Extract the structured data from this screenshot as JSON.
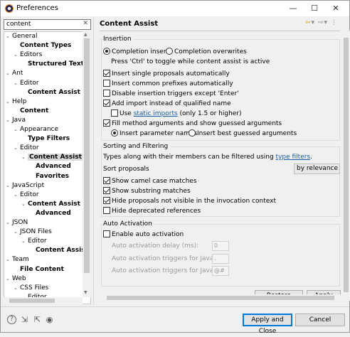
{
  "window": {
    "title": "Preferences",
    "minimize": "—",
    "maximize": "☐",
    "close": "✕"
  },
  "filter": {
    "value": "content",
    "clear": "✕"
  },
  "tree": [
    {
      "label": "General",
      "expander": "⌄",
      "bold": false
    },
    {
      "label": "Content Types",
      "expander": "",
      "bold": true
    },
    {
      "label": "Editors",
      "expander": "⌄",
      "bold": false
    },
    {
      "label": "Structured Text Ed",
      "expander": "",
      "bold": true
    },
    {
      "label": "Ant",
      "expander": "⌄",
      "bold": false
    },
    {
      "label": "Editor",
      "expander": "⌄",
      "bold": false
    },
    {
      "label": "Content Assist",
      "expander": "",
      "bold": true
    },
    {
      "label": "Help",
      "expander": "⌄",
      "bold": false
    },
    {
      "label": "Content",
      "expander": "",
      "bold": true
    },
    {
      "label": "Java",
      "expander": "⌄",
      "bold": false
    },
    {
      "label": "Appearance",
      "expander": "⌄",
      "bold": false
    },
    {
      "label": "Type Filters",
      "expander": "",
      "bold": true
    },
    {
      "label": "Editor",
      "expander": "⌄",
      "bold": false
    },
    {
      "label": "Content Assist",
      "expander": "⌄",
      "bold": true,
      "selected": true
    },
    {
      "label": "Advanced",
      "expander": "",
      "bold": true
    },
    {
      "label": "Favorites",
      "expander": "",
      "bold": true
    },
    {
      "label": "JavaScript",
      "expander": "⌄",
      "bold": false
    },
    {
      "label": "Editor",
      "expander": "⌄",
      "bold": false
    },
    {
      "label": "Content Assist",
      "expander": "⌄",
      "bold": true
    },
    {
      "label": "Advanced",
      "expander": "",
      "bold": true
    },
    {
      "label": "JSON",
      "expander": "⌄",
      "bold": false
    },
    {
      "label": "JSON Files",
      "expander": "⌄",
      "bold": false
    },
    {
      "label": "Editor",
      "expander": "⌄",
      "bold": false
    },
    {
      "label": "Content Assist",
      "expander": "",
      "bold": true
    },
    {
      "label": "Team",
      "expander": "⌄",
      "bold": false
    },
    {
      "label": "File Content",
      "expander": "",
      "bold": true
    },
    {
      "label": "Web",
      "expander": "⌄",
      "bold": false
    },
    {
      "label": "CSS Files",
      "expander": "⌄",
      "bold": false
    },
    {
      "label": "Editor",
      "expander": "⌄",
      "bold": false
    }
  ],
  "page": {
    "title": "Content Assist",
    "nav": {
      "back": "⇦",
      "back_menu": "▾",
      "forward": "⇨",
      "forward_menu": "▾",
      "menu": "⋮"
    }
  },
  "insertion": {
    "title": "Insertion",
    "completion_inserts": "Completion inserts",
    "completion_overwrites": "Completion overwrites",
    "toggle_hint": "Press 'Ctrl' to toggle while content assist is active",
    "insert_single": "Insert single proposals automatically",
    "insert_common": "Insert common prefixes automatically",
    "disable_triggers": "Disable insertion triggers except 'Enter'",
    "add_import": "Add import instead of qualified name",
    "use_static_use": "Use ",
    "use_static_link": "static imports",
    "use_static_tail": " (only 1.5 or higher)",
    "fill_args": "Fill method arguments and show guessed arguments",
    "insert_param_names": "Insert parameter names",
    "insert_best_guessed": "Insert best guessed arguments"
  },
  "sorting": {
    "title": "Sorting and Filtering",
    "desc_pre": "Types along with their members can be filtered using ",
    "desc_link": "type filters",
    "desc_post": ".",
    "sort_label": "Sort proposals",
    "sort_value": "by relevance",
    "camel": "Show camel case matches",
    "substring": "Show substring matches",
    "hide_invisible": "Hide proposals not visible in the invocation context",
    "hide_deprecated": "Hide deprecated references"
  },
  "activation": {
    "title": "Auto Activation",
    "enable": "Enable auto activation",
    "delay_label": "Auto activation delay (ms):",
    "delay_value": "0",
    "java_label": "Auto activation triggers for Java:",
    "java_value": ".",
    "javadoc_label": "Auto activation triggers for Javadoc:",
    "javadoc_value": "@#"
  },
  "buttons": {
    "restore": "Restore Defaults",
    "apply": "Apply",
    "apply_close": "Apply and Close",
    "cancel": "Cancel"
  },
  "footer_icons": {
    "help": "?",
    "import": "⇲",
    "export": "⇱",
    "oomph": "◉"
  }
}
